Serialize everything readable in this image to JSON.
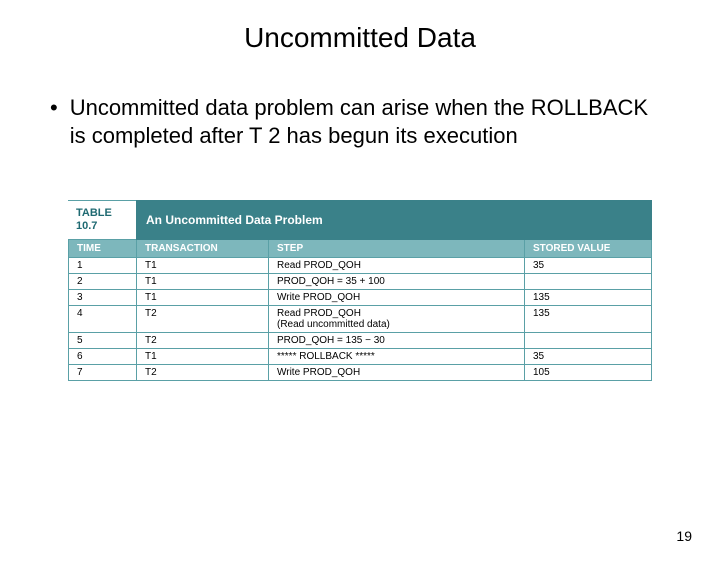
{
  "title": "Uncommitted Data",
  "bullet": "Uncommitted data problem can arise when the ROLLBACK is completed after T 2 has begun its execution",
  "table": {
    "label_line1": "TABLE",
    "label_line2": "10.7",
    "caption": "An Uncommitted Data Problem",
    "headers": [
      "TIME",
      "TRANSACTION",
      "STEP",
      "STORED VALUE"
    ],
    "rows": [
      {
        "time": "1",
        "txn": "T1",
        "step": "Read PROD_QOH",
        "val": "35"
      },
      {
        "time": "2",
        "txn": "T1",
        "step": "PROD_QOH = 35 + 100",
        "val": ""
      },
      {
        "time": "3",
        "txn": "T1",
        "step": "Write PROD_QOH",
        "val": "135"
      },
      {
        "time": "4",
        "txn": "T2",
        "step": "Read PROD_QOH",
        "sub": "(Read uncommitted data)",
        "val": "135"
      },
      {
        "time": "5",
        "txn": "T2",
        "step": "PROD_QOH = 135 − 30",
        "val": ""
      },
      {
        "time": "6",
        "txn": "T1",
        "step": "***** ROLLBACK *****",
        "val": "35"
      },
      {
        "time": "7",
        "txn": "T2",
        "step": "Write PROD_QOH",
        "val": "105"
      }
    ]
  },
  "pageNumber": "19"
}
